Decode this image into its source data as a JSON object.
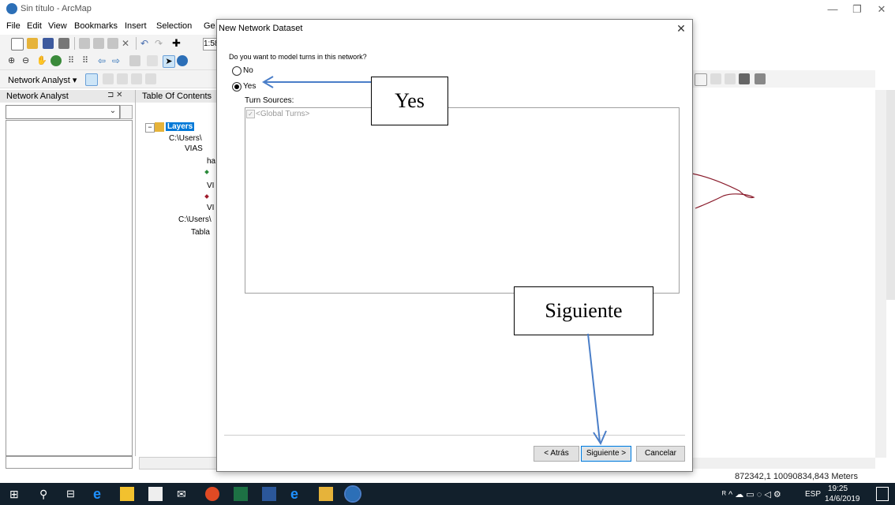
{
  "window": {
    "title": "Sin título - ArcMap"
  },
  "menu": [
    "File",
    "Edit",
    "View",
    "Bookmarks",
    "Insert",
    "Selection",
    "Ge"
  ],
  "toolbar": {
    "scale_text": "1:58.8"
  },
  "network_analyst": {
    "panel_title": "Network Analyst",
    "dropdown_label": "Network Analyst ▾"
  },
  "toc": {
    "title": "Table Of Contents",
    "items": [
      "Layers",
      "C:\\Users\\",
      "VIAS",
      "ha",
      "VI",
      "VI",
      "C:\\Users\\",
      "Tabla"
    ]
  },
  "dialog": {
    "title": "New Network Dataset",
    "question": "Do you want to model turns in this network?",
    "option_no": "No",
    "option_yes": "Yes",
    "selected": "Yes",
    "turn_sources_label": "Turn Sources:",
    "turn_sources": [
      "<Global Turns>"
    ],
    "buttons": {
      "back": "< Atrás",
      "next": "Siguiente >",
      "cancel": "Cancelar"
    }
  },
  "annotations": {
    "yes": "Yes",
    "next": "Siguiente"
  },
  "status": {
    "coords": "872342,1  10090834,843 Meters"
  },
  "taskbar": {
    "lang": "ESP",
    "time": "19:25",
    "date": "14/6/2019"
  },
  "colors": {
    "accent": "#0078d7",
    "arrow": "#4a7ec8",
    "taskbar": "#12202c"
  }
}
